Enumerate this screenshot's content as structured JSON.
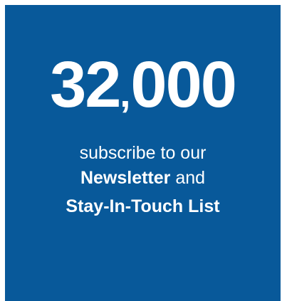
{
  "stat": {
    "number_lead": "32",
    "comma": ",",
    "number_tail": "000"
  },
  "caption": {
    "line1": "subscribe to our",
    "newsletter": "Newsletter",
    "and": " and",
    "list": "Stay-In-Touch List"
  },
  "colors": {
    "panel_background": "#08599a",
    "text": "#ffffff",
    "page_background": "#ffffff"
  }
}
